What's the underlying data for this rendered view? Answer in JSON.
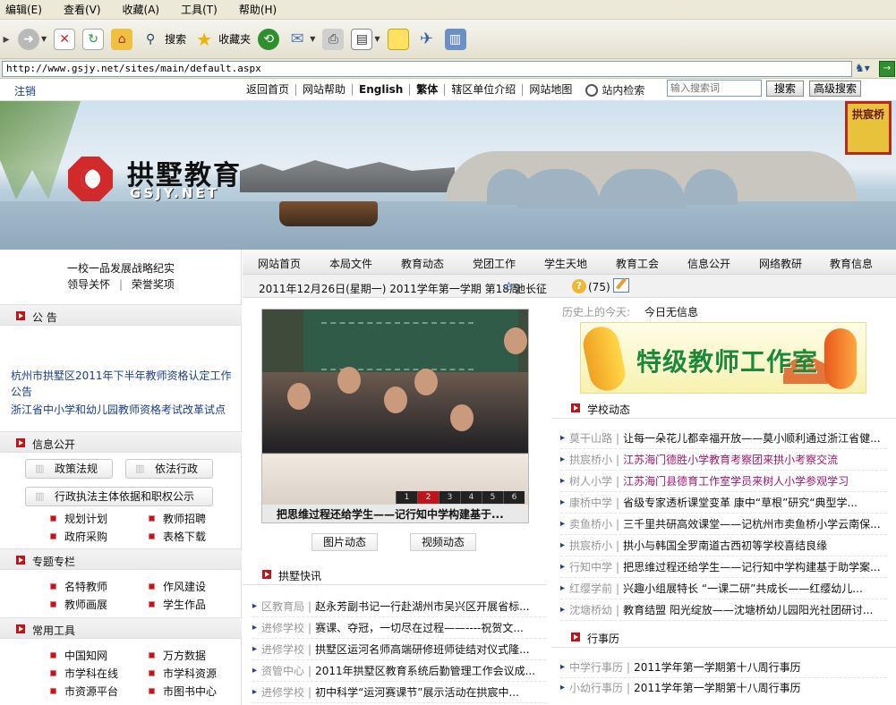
{
  "browser": {
    "menu": [
      "编辑(E)",
      "查看(V)",
      "收藏(A)",
      "工具(T)",
      "帮助(H)"
    ],
    "toolbar": {
      "search_label": "搜索",
      "favorites_label": "收藏夹"
    },
    "address": "http://www.gsjy.net/sites/main/default.aspx"
  },
  "sitenav": {
    "logout": "注销",
    "links": [
      "返回首页",
      "网站帮助",
      "English",
      "繁体",
      "辖区单位介绍",
      "网站地图"
    ],
    "site_search_label": "站内检索",
    "search_placeholder": "输入搜索词",
    "search_button": "搜索",
    "advanced_button": "高级搜索"
  },
  "banner": {
    "logo_cn": "拱墅教育",
    "logo_en": "GSJY.NET",
    "seal": "拱宸桥"
  },
  "left": {
    "links_line1": "一校一品发展战略纪实",
    "links_line2a": "领导关怀",
    "links_line2b": "荣誉奖项",
    "notice_head": "公 告",
    "notices": [
      "杭州市拱墅区2011年下半年教师资格认定工作公告",
      "浙江省中小学和幼儿园教师资格考试改革试点"
    ],
    "info_head": "信息公开",
    "info_pills": [
      "政策法规",
      "依法行政",
      "行政执法主体依据和职权公示"
    ],
    "info_links": [
      "规划计划",
      "教师招聘",
      "政府采购",
      "表格下载"
    ],
    "topic_head": "专题专栏",
    "topic_links": [
      "名特教师",
      "作风建设",
      "教师画展",
      "学生作品"
    ],
    "tools_head": "常用工具",
    "tools_links": [
      "中国知网",
      "万方数据",
      "市学科在线",
      "市学科资源",
      "市资源平台",
      "市图书中心"
    ]
  },
  "mainnav": [
    "网站首页",
    "本局文件",
    "教育动态",
    "党团工作",
    "学生天地",
    "教育工会",
    "信息公开",
    "网络教研",
    "教育信息"
  ],
  "datebar": {
    "date": "2011年12月26日(星期一) 2011学年第一学期 第18周",
    "user": "池长征",
    "count": "(75)"
  },
  "slide": {
    "caption": "把思维过程还给学生——记行知中学构建基于...",
    "pages": [
      "1",
      "2",
      "3",
      "4",
      "5",
      "6"
    ],
    "active_page": "2"
  },
  "center": {
    "photo_tab": "图片动态",
    "video_tab": "视频动态",
    "news_head": "拱墅快讯",
    "news": [
      {
        "src": "区教育局",
        "title": "赵永芳副书记一行赴湖州市吴兴区开展省标..."
      },
      {
        "src": "进修学校",
        "title": "赛课、夺冠，一切尽在过程——----祝贺文..."
      },
      {
        "src": "进修学校",
        "title": "拱墅区运河名师高端研修班师徒结对仪式隆..."
      },
      {
        "src": "资管中心",
        "title": "2011年拱墅区教育系统后勤管理工作会议成..."
      },
      {
        "src": "进修学校",
        "title": "初中科学“运河赛课节”展示活动在拱宸中..."
      }
    ]
  },
  "right": {
    "history_label": "历史上的今天:",
    "history_value": "今日无信息",
    "teacher_banner": "特级教师工作室",
    "school_head": "学校动态",
    "school_news": [
      {
        "src": "莫干山路",
        "title": "让每一朵花儿都幸福开放——莫小顺利通过浙江省健...",
        "hl": false
      },
      {
        "src": "拱宸桥小",
        "title": "江苏海门德胜小学教育考察团来拱小考察交流",
        "hl": true
      },
      {
        "src": "树人小学",
        "title": "江苏海门县德育工作室学员来树人小学参观学习",
        "hl": true
      },
      {
        "src": "康桥中学",
        "title": "省级专家透析课堂变革 康中“草根”研究“典型学...",
        "hl": false
      },
      {
        "src": "卖鱼桥小",
        "title": "三千里共研高效课堂——记杭州市卖鱼桥小学云南保...",
        "hl": false
      },
      {
        "src": "拱宸桥小",
        "title": "拱小与韩国全罗南道古西初等学校喜结良缘",
        "hl": false
      },
      {
        "src": "行知中学",
        "title": "把思维过程还给学生——记行知中学构建基于助学案...",
        "hl": false
      },
      {
        "src": "红缨学前",
        "title": "兴趣小组展特长 “一课二研”共成长——红缨幼儿...",
        "hl": false
      },
      {
        "src": "沈塘桥幼",
        "title": "教育结盟 阳光绽放——沈塘桥幼儿园阳光社团研讨...",
        "hl": false
      }
    ],
    "calendar_head": "行事历",
    "calendar": [
      {
        "src": "中学行事历",
        "title": "2011学年第一学期第十八周行事历"
      },
      {
        "src": "小幼行事历",
        "title": "2011学年第一学期第十八周行事历"
      }
    ]
  }
}
